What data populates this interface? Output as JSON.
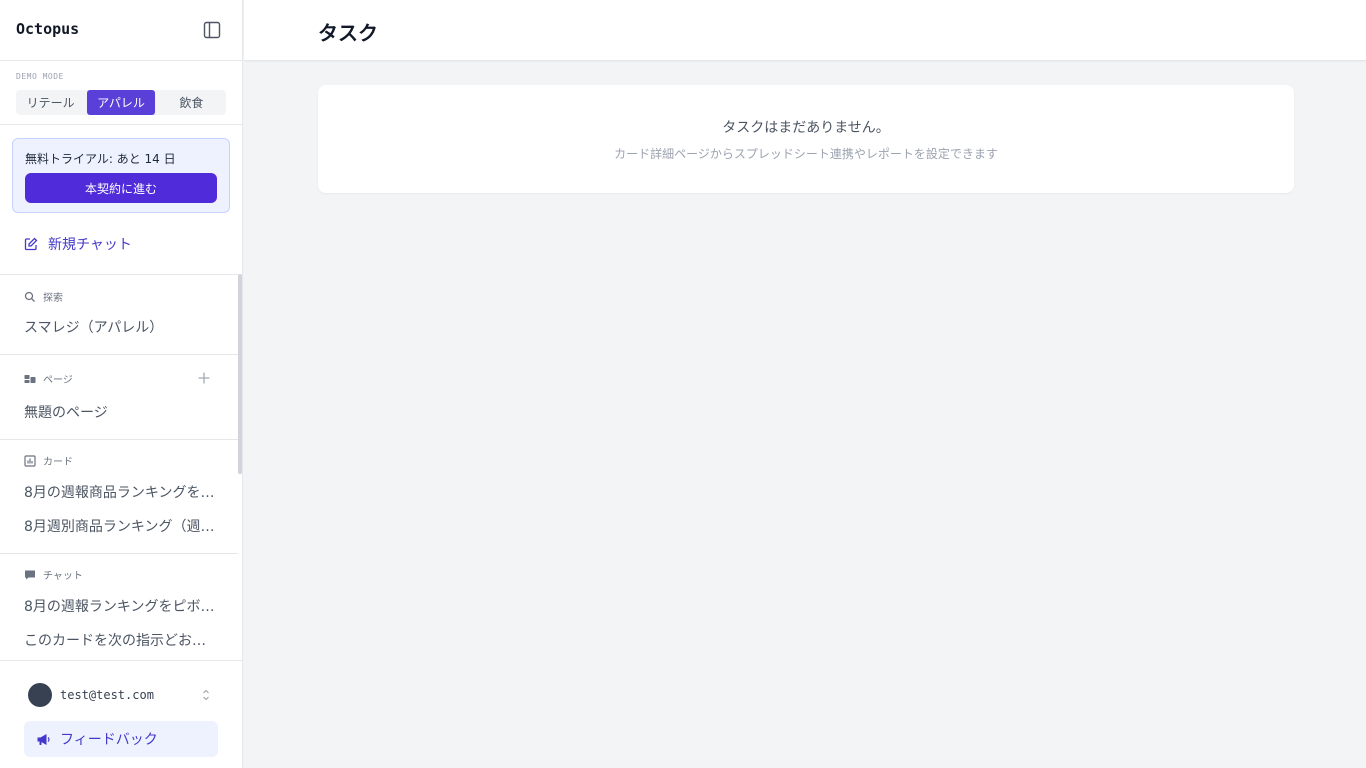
{
  "app": {
    "name": "Octopus"
  },
  "demo_mode": {
    "label": "DEMO MODE",
    "options": [
      "リテール",
      "アパレル",
      "飲食"
    ],
    "selected": "アパレル"
  },
  "trial": {
    "text": "無料トライアル: あと 14 日",
    "button_label": "本契約に進む"
  },
  "new_chat": {
    "label": "新規チャット"
  },
  "sections": {
    "explore": {
      "title": "探索",
      "items": [
        "スマレジ（アパレル）"
      ]
    },
    "pages": {
      "title": "ページ",
      "items": [
        "無題のページ"
      ]
    },
    "cards": {
      "title": "カード",
      "items": [
        "8月の週報商品ランキングを…",
        "8月週別商品ランキング（週x…"
      ]
    },
    "chats": {
      "title": "チャット",
      "items": [
        "8月の週報ランキングをピボ…",
        "このカードを次の指示どおり…"
      ]
    }
  },
  "user": {
    "email": "test@test.com"
  },
  "feedback": {
    "label": "フィードバック"
  },
  "main": {
    "title": "タスク",
    "empty_title": "タスクはまだありません。",
    "empty_subtitle": "カード詳細ページからスプレッドシート連携やレポートを設定できます"
  },
  "colors": {
    "accent": "#5b3fd9",
    "button": "#4f2bd9",
    "link": "#4338ca"
  }
}
